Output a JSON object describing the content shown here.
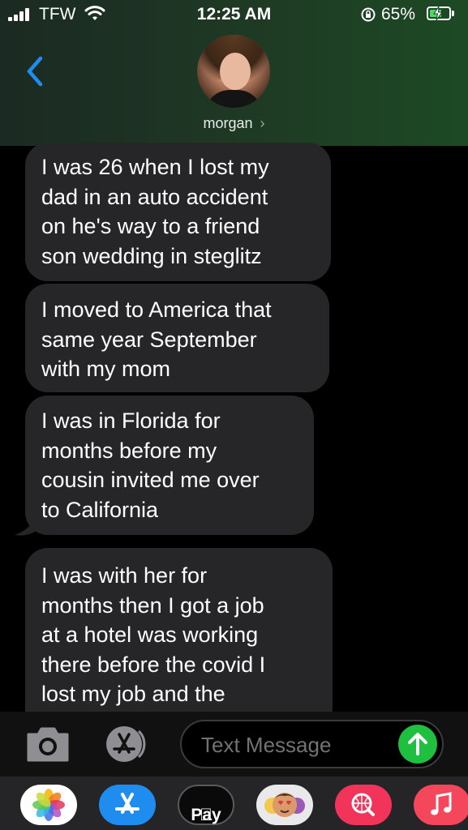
{
  "status_bar": {
    "carrier": "TFW",
    "time": "12:25 AM",
    "battery_percent": "65%",
    "battery_level": 0.65,
    "icons": [
      "signal-bars-icon",
      "wifi-icon",
      "rotation-lock-icon",
      "battery-charging-icon"
    ]
  },
  "header": {
    "back_icon": "chevron-left-icon",
    "contact_name": "morgan",
    "contact_chevron": "›"
  },
  "messages": [
    {
      "direction": "incoming",
      "lines": [
        "I was 26 when I lost my",
        "dad in an auto  accident",
        "on he's way to a friend",
        "son wedding in steglitz"
      ]
    },
    {
      "direction": "incoming",
      "lines": [
        "I moved to America that",
        "same year September",
        "with my mom"
      ]
    },
    {
      "direction": "incoming",
      "lines": [
        "I was in Florida for",
        "months before my",
        "cousin invited me over",
        "to California"
      ]
    },
    {
      "direction": "incoming",
      "lines": [
        "I was with her for",
        "months then I got a job",
        "at a hotel was working",
        "there before the covid I",
        "lost my job and the"
      ]
    }
  ],
  "composer": {
    "placeholder": "Text Message",
    "camera_icon": "camera-icon",
    "apps_icon": "app-store-icon",
    "send_icon": "arrow-up-icon"
  },
  "app_drawer": {
    "apps": [
      "photos-icon",
      "app-store-icon",
      "apple-pay-icon",
      "memoji-icon",
      "search-web-icon",
      "music-icon"
    ],
    "pay_label": "Pay"
  },
  "colors": {
    "bubble_incoming": "#262628",
    "send_button": "#1fbf40",
    "back_accent": "#1f8cf0",
    "header_gradient_end": "#1d4a24"
  }
}
